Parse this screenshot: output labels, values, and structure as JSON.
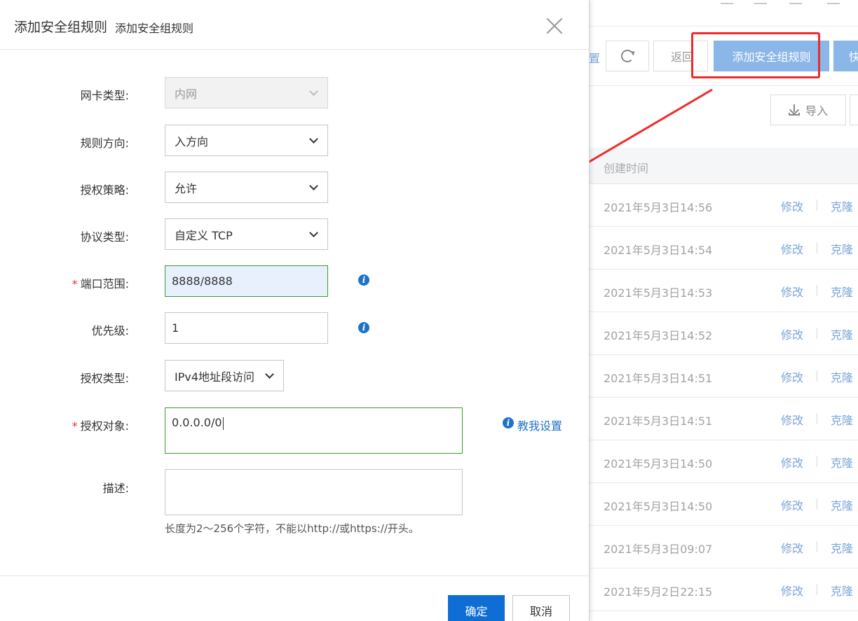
{
  "dialog": {
    "title": "添加安全组规则",
    "subtitle": "添加安全组规则",
    "form": {
      "nic_type_label": "网卡类型:",
      "nic_type_value": "内网",
      "direction_label": "规则方向:",
      "direction_value": "入方向",
      "policy_label": "授权策略:",
      "policy_value": "允许",
      "protocol_label": "协议类型:",
      "protocol_value": "自定义 TCP",
      "port_label": "端口范围:",
      "port_value": "8888/8888",
      "priority_label": "优先级:",
      "priority_value": "1",
      "auth_type_label": "授权类型:",
      "auth_type_value": "IPv4地址段访问",
      "auth_object_label": "授权对象:",
      "auth_object_value": "0.0.0.0/0",
      "help_link": "教我设置",
      "desc_label": "描述:",
      "desc_value": "",
      "desc_hint": "长度为2～256个字符，不能以http://或https://开头。",
      "required_mark": "*"
    },
    "footer": {
      "ok_label": "确定",
      "cancel_label": "取消"
    }
  },
  "background": {
    "toolbar": {
      "settings_fragment": "置",
      "back_label": "返回",
      "add_rule_label": "添加安全组规则",
      "quick_fragment": "快",
      "import_label": "导入"
    },
    "table": {
      "column_created": "创建时间",
      "modify_label": "修改",
      "clone_label": "克隆",
      "rows": [
        {
          "time": "2021年5月3日14:56"
        },
        {
          "time": "2021年5月3日14:54"
        },
        {
          "time": "2021年5月3日14:53"
        },
        {
          "time": "2021年5月3日14:52"
        },
        {
          "time": "2021年5月3日14:51"
        },
        {
          "time": "2021年5月3日14:51"
        },
        {
          "time": "2021年5月3日14:50"
        },
        {
          "time": "2021年5月3日14:50"
        },
        {
          "time": "2021年5月3日09:07"
        },
        {
          "time": "2021年5月2日22:15"
        }
      ]
    }
  },
  "colors": {
    "primary": "#0f6ed6",
    "valid_border": "#3b9b2f",
    "required": "#e5322d",
    "annotation": "#ee2b2b",
    "link": "#1e73c9"
  }
}
